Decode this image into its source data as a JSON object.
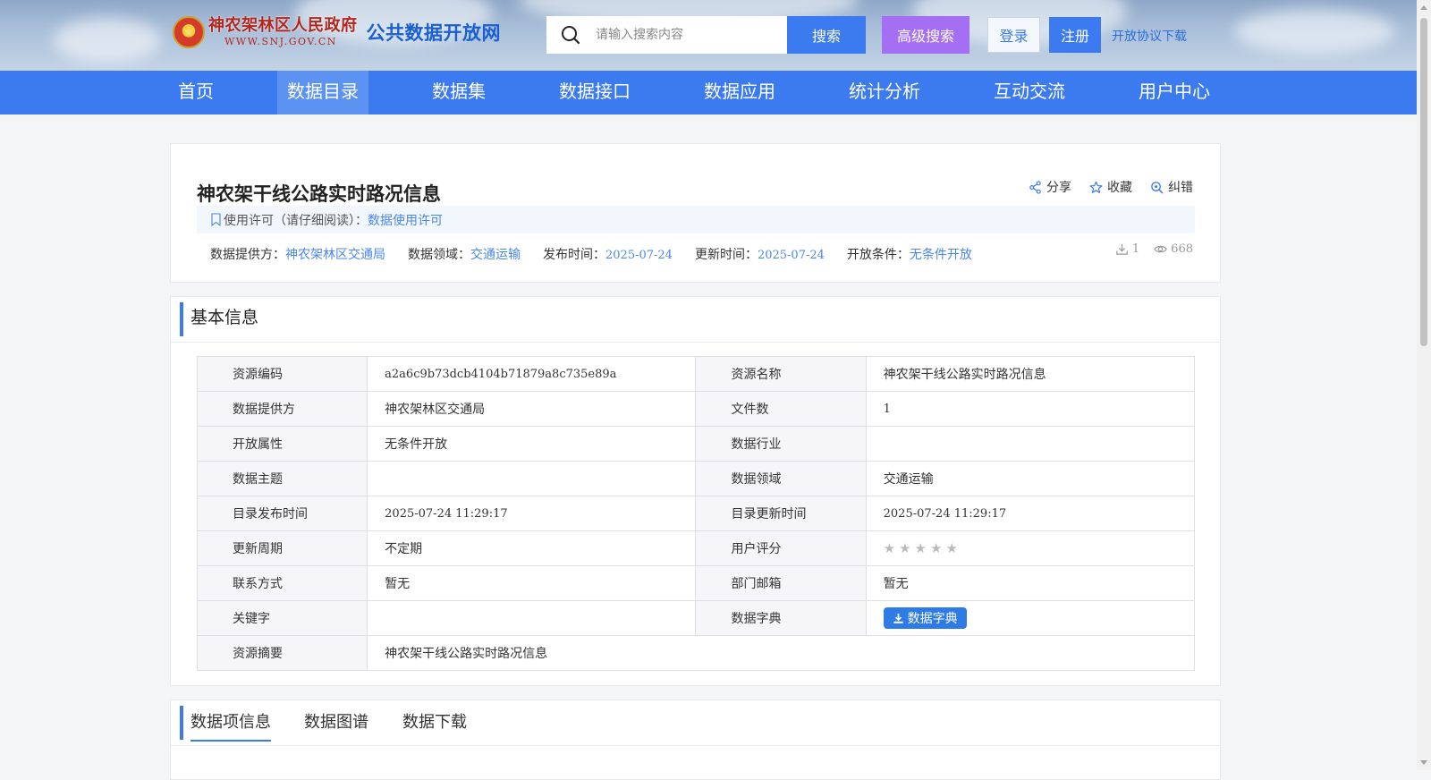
{
  "header": {
    "gov_name": "神农架林区人民政府",
    "gov_url": "WWW.SNJ.GOV.CN",
    "portal_name": "公共数据开放网",
    "search_placeholder": "请输入搜索内容",
    "search_button": "搜索",
    "advanced_search": "高级搜索",
    "login": "登录",
    "register": "注册",
    "agreement_download": "开放协议下载"
  },
  "nav": {
    "items": [
      "首页",
      "数据目录",
      "数据集",
      "数据接口",
      "数据应用",
      "统计分析",
      "互动交流",
      "用户中心"
    ],
    "active": "数据目录"
  },
  "resource": {
    "title": "神农架干线公路实时路况信息",
    "actions": {
      "share": "分享",
      "favorite": "收藏",
      "correct": "纠错"
    },
    "license_label": "使用许可（请仔细阅读）：",
    "license_link": "数据使用许可",
    "meta": {
      "provider_label": "数据提供方：",
      "provider": "神农架林区交通局",
      "domain_label": "数据领域：",
      "domain": "交通运输",
      "publish_label": "发布时间：",
      "publish": "2025-07-24",
      "update_label": "更新时间：",
      "update": "2025-07-24",
      "open_label": "开放条件：",
      "open": "无条件开放"
    },
    "stats": {
      "downloads": "1",
      "views": "668"
    }
  },
  "basic_info": {
    "section_title": "基本信息",
    "rows": [
      {
        "l1": "资源编码",
        "v1": "a2a6c9b73dcb4104b71879a8c735e89a",
        "l2": "资源名称",
        "v2": "神农架干线公路实时路况信息"
      },
      {
        "l1": "数据提供方",
        "v1": "神农架林区交通局",
        "l2": "文件数",
        "v2": "1"
      },
      {
        "l1": "开放属性",
        "v1": "无条件开放",
        "l2": "数据行业",
        "v2": ""
      },
      {
        "l1": "数据主题",
        "v1": "",
        "l2": "数据领域",
        "v2": "交通运输"
      },
      {
        "l1": "目录发布时间",
        "v1": "2025-07-24 11:29:17",
        "l2": "目录更新时间",
        "v2": "2025-07-24 11:29:17"
      },
      {
        "l1": "更新周期",
        "v1": "不定期",
        "l2": "用户评分",
        "v2": ""
      },
      {
        "l1": "联系方式",
        "v1": "暂无",
        "l2": "部门邮箱",
        "v2": "暂无"
      },
      {
        "l1": "关键字",
        "v1": "",
        "l2": "数据字典",
        "v2": ""
      },
      {
        "l1": "资源摘要",
        "v1": "神农架干线公路实时路况信息"
      }
    ],
    "rating": 0,
    "dict_button": "数据字典"
  },
  "tabs": {
    "items": [
      "数据项信息",
      "数据图谱",
      "数据下载"
    ],
    "active": "数据项信息"
  },
  "colors": {
    "primary": "#3b7bef",
    "advanced": "#a46ff2",
    "link": "#4a87ea"
  }
}
